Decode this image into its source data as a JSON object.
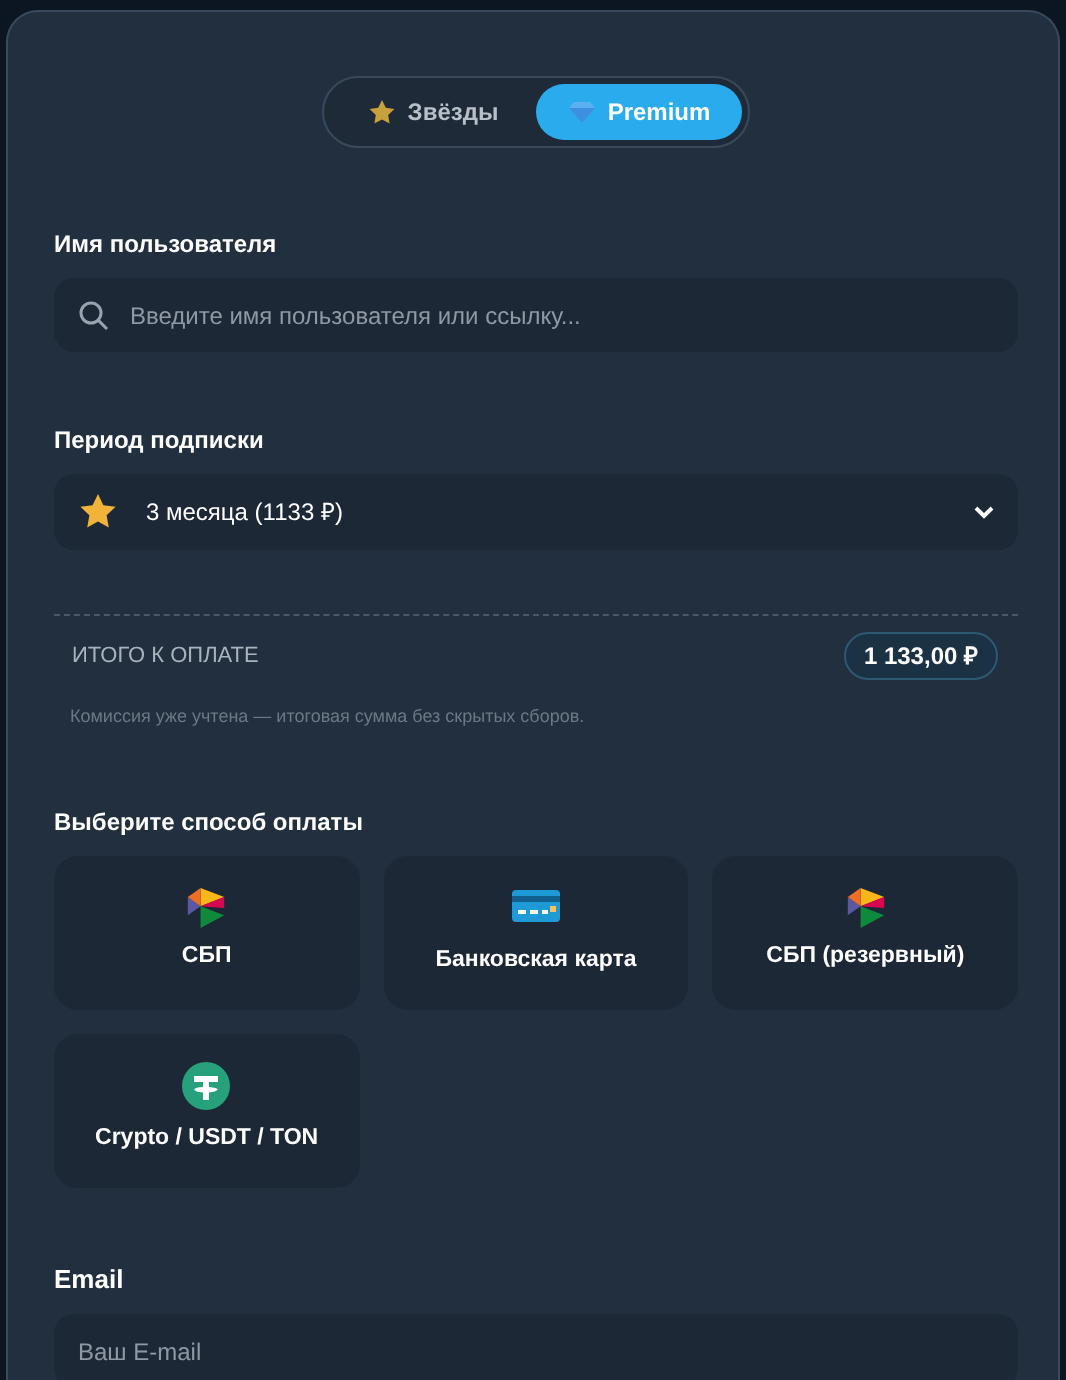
{
  "tabs": [
    {
      "label": "Звёзды",
      "kind": "star",
      "selected": false
    },
    {
      "label": "Premium",
      "kind": "diamond",
      "selected": true
    }
  ],
  "username": {
    "label": "Имя пользователя",
    "placeholder": "Введите имя пользователя или ссылку..."
  },
  "period": {
    "label": "Период подписки",
    "value": "3 месяца (1133 ₽)"
  },
  "total": {
    "label": "ИТОГО К ОПЛАТЕ",
    "amount": "1 133,00 ₽",
    "note": "Комиссия уже учтена — итоговая сумма без скрытых сборов."
  },
  "payment": {
    "label": "Выберите способ оплаты",
    "methods": [
      {
        "kind": "sbp",
        "label": "СБП",
        "selected": false
      },
      {
        "kind": "card",
        "label": "Банковская карта",
        "selected": false
      },
      {
        "kind": "sbp",
        "label": "СБП (резервный)",
        "selected": false
      },
      {
        "kind": "usdt",
        "label": "Crypto / USDT / TON",
        "selected": false
      }
    ]
  },
  "email": {
    "label": "Email",
    "placeholder": "Ваш E-mail"
  }
}
